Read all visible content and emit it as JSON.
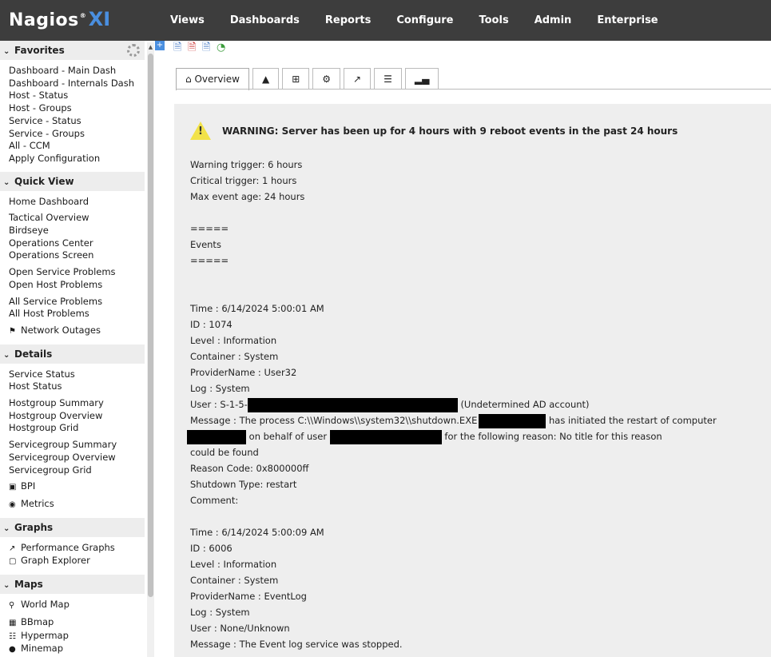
{
  "logo": {
    "brand": "Nagios",
    "mark": "®",
    "xi": "XI"
  },
  "nav": [
    "Views",
    "Dashboards",
    "Reports",
    "Configure",
    "Tools",
    "Admin",
    "Enterprise"
  ],
  "sidebar": {
    "favorites": {
      "title": "Favorites",
      "items": [
        "Dashboard - Main Dash",
        "Dashboard - Internals Dash",
        "Host - Status",
        "Host - Groups",
        "Service - Status",
        "Service - Groups",
        "All - CCM",
        "Apply Configuration"
      ]
    },
    "quickview": {
      "title": "Quick View",
      "items": [
        "Home Dashboard",
        "Tactical Overview",
        "Birdseye",
        "Operations Center",
        "Operations Screen",
        "Open Service Problems",
        "Open Host Problems",
        "All Service Problems",
        "All Host Problems",
        "Network Outages"
      ]
    },
    "details": {
      "title": "Details",
      "items": [
        "Service Status",
        "Host Status",
        "Hostgroup Summary",
        "Hostgroup Overview",
        "Hostgroup Grid",
        "Servicegroup Summary",
        "Servicegroup Overview",
        "Servicegroup Grid",
        "BPI",
        "Metrics"
      ]
    },
    "graphs": {
      "title": "Graphs",
      "items": [
        "Performance Graphs",
        "Graph Explorer"
      ]
    },
    "maps": {
      "title": "Maps",
      "items": [
        "World Map",
        "BBmap",
        "Hypermap",
        "Minemap"
      ]
    }
  },
  "tabs": {
    "overview": "Overview"
  },
  "warning": "WARNING: Server has been up for 4 hours with 9 reboot events in the past 24 hours",
  "details": {
    "warning_trigger": "Warning trigger: 6 hours",
    "critical_trigger": "Critical trigger: 1 hours",
    "max_event_age": "Max event age: 24 hours",
    "sep": "=====",
    "events": "Events"
  },
  "event1": {
    "time": "Time : 6/14/2024 5:00:01 AM",
    "id": "ID : 1074",
    "level": "Level : Information",
    "container": "Container : System",
    "provider": "ProviderName : User32",
    "log": "Log : System",
    "user_prefix": "User : S-1-5-",
    "user_suffix": "(Undetermined AD account)",
    "msg_a": "Message : The process C:\\\\Windows\\\\system32\\\\shutdown.EXE",
    "msg_b": "has initiated the restart of computer",
    "msg_c": "on behalf of user",
    "msg_d": "for the following reason: No title for this reason",
    "msg_e": "could be found",
    "reason": "Reason Code: 0x800000ff",
    "shutdown": "Shutdown Type: restart",
    "comment": "Comment:"
  },
  "event2": {
    "time": "Time : 6/14/2024 5:00:09 AM",
    "id": "ID : 6006",
    "level": "Level : Information",
    "container": "Container : System",
    "provider": "ProviderName : EventLog",
    "log": "Log : System",
    "user": "User : None/Unknown",
    "message": "Message : The Event log service was stopped."
  }
}
